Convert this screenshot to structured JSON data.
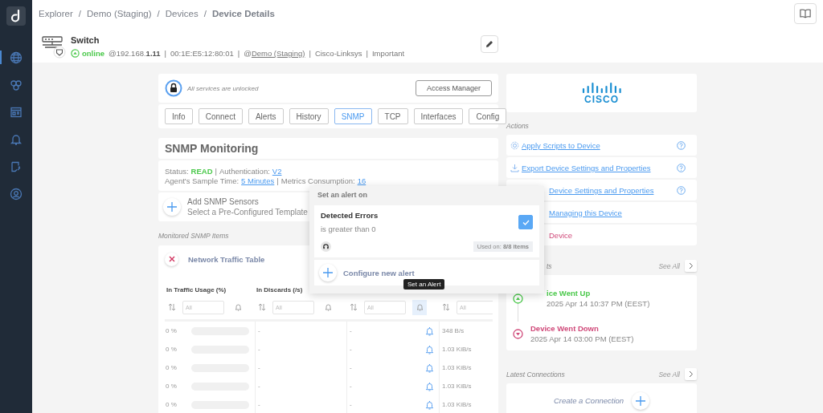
{
  "sidebar": {
    "items": [
      {
        "selected": true
      },
      {
        "selected": false
      },
      {
        "selected": false
      },
      {
        "selected": false
      },
      {
        "selected": false
      },
      {
        "selected": false
      }
    ]
  },
  "breadcrumb": {
    "separator": "/",
    "items": [
      "Explorer",
      "Demo (Staging)",
      "Devices",
      "Device Details"
    ]
  },
  "device": {
    "name": "Switch",
    "status": "online",
    "separator": "|",
    "details": [
      {
        "kind": "text",
        "text": "@192.168.**1.11**"
      },
      {
        "kind": "text",
        "text": "00:1E:E5:12:80:01"
      },
      {
        "kind": "link",
        "prefix": "@",
        "text": "Demo (Staging)"
      },
      {
        "kind": "text",
        "text": "Cisco-Linksys"
      },
      {
        "kind": "text",
        "text": "Important"
      }
    ]
  },
  "access": {
    "note": "All services are unlocked",
    "button": "Access Manager"
  },
  "tabs": [
    {
      "label": "Info",
      "selected": false
    },
    {
      "label": "Connect",
      "selected": false
    },
    {
      "label": "Alerts",
      "selected": false
    },
    {
      "label": "History",
      "selected": false
    },
    {
      "label": "SNMP",
      "selected": true
    },
    {
      "label": "TCP",
      "selected": false
    },
    {
      "label": "Interfaces",
      "selected": false
    },
    {
      "label": "Config",
      "selected": false
    }
  ],
  "snmp": {
    "title": "SNMP Monitoring",
    "status_label": "Status:",
    "status_value": "READ",
    "separator": "|",
    "auth_label": "Authentication:",
    "auth_value": "V2",
    "sample_label": "Agent's Sample Time:",
    "sample_value": "5 Minutes",
    "metrics_label": "Metrics Consumption:",
    "metrics_value": "16",
    "add_title": "Add SNMP Sensors",
    "add_subtitle": "Select a Pre-Configured Template"
  },
  "monitored_label": "Monitored SNMP Items",
  "table": {
    "title": "Network Traffic Table",
    "columns": [
      {
        "label": "In Traffic Usage (%)",
        "filter_placeholder": "All",
        "alert_selected": false
      },
      {
        "label": "In Discards (/s)",
        "filter_placeholder": "All",
        "alert_selected": false
      },
      {
        "filter_placeholder": "All",
        "alert_selected": true
      },
      {
        "filter_placeholder": "All"
      }
    ],
    "rows": [
      {
        "column_1": "0 %",
        "level": 0,
        "column_2": "-",
        "column_3": "-",
        "column_4": "348 B/s"
      },
      {
        "column_1": "0 %",
        "level": 0,
        "column_2": "-",
        "column_3": "-",
        "column_4": "1.03 KiB/s"
      },
      {
        "column_1": "0 %",
        "level": 0,
        "column_2": "-",
        "column_3": "-",
        "column_4": "1.03 KiB/s"
      },
      {
        "column_1": "0 %",
        "level": 0,
        "column_2": "-",
        "column_3": "-",
        "column_4": "1.03 KiB/s"
      },
      {
        "column_1": "0 %",
        "level": 0,
        "column_2": "-",
        "column_3": "-",
        "column_4": "1.03 KiB/s"
      }
    ]
  },
  "alert_popover": {
    "title": "Set an alert on",
    "alerts": [
      {
        "name": "Detected Errors",
        "condition": "is greater than 0",
        "checked": true,
        "usage_label": "Used on:",
        "usage_value": "8/8 items"
      }
    ],
    "configure": "Configure new alert",
    "tooltip": "Set an Alert"
  },
  "vendor_logo": "CISCO",
  "actions": {
    "title": "Actions",
    "items": [
      {
        "label": "Apply Scripts to Device",
        "danger": false,
        "help": true
      },
      {
        "label": "Export Device Settings and Properties",
        "danger": false,
        "help": true
      },
      {
        "label": "Device Settings and Properties",
        "danger": false,
        "help": true
      },
      {
        "label": "Managing this Device",
        "danger": false,
        "help": false
      },
      {
        "label": "Device",
        "danger": true,
        "help": false
      }
    ]
  },
  "events": {
    "title": "ts",
    "see_all": "See All",
    "items": [
      {
        "kind": "up",
        "title": "ice Went Up",
        "time": "2025 Apr 14 10:37 PM (EEST)"
      },
      {
        "kind": "down",
        "title": "Device Went Down",
        "time": "2025 Apr 14 03:00 PM (EEST)"
      }
    ]
  },
  "connections": {
    "title": "Latest Connections",
    "see_all": "See All",
    "create": "Create a Connection"
  }
}
